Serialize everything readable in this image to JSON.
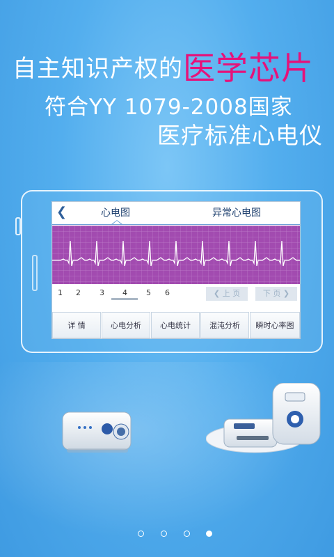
{
  "headline": {
    "line1_prefix": "自主知识产权的",
    "line1_accent": "医学芯片",
    "line2": "符合YY 1079-2008国家",
    "line3": "医疗标准心电仪"
  },
  "screen": {
    "tabs": [
      "心电图",
      "异常心电图"
    ],
    "pages": [
      "1",
      "2",
      "3",
      "4",
      "5",
      "6"
    ],
    "current_page": "4",
    "prev_label": "上 页",
    "next_label": "下 页",
    "menu": [
      "详  情",
      "心电分析",
      "心电统计",
      "混沌分析",
      "瞬时心率图"
    ]
  },
  "colors": {
    "accent": "#e6127a",
    "ecg_grid": "#a53fb1",
    "ecg_bg": "#a24bb0"
  },
  "icons": {
    "back": "chevron-left-icon",
    "prev_arrow": "chevron-left-icon",
    "next_arrow": "chevron-right-icon"
  },
  "pagination": {
    "count": 4,
    "active_index": 3
  }
}
